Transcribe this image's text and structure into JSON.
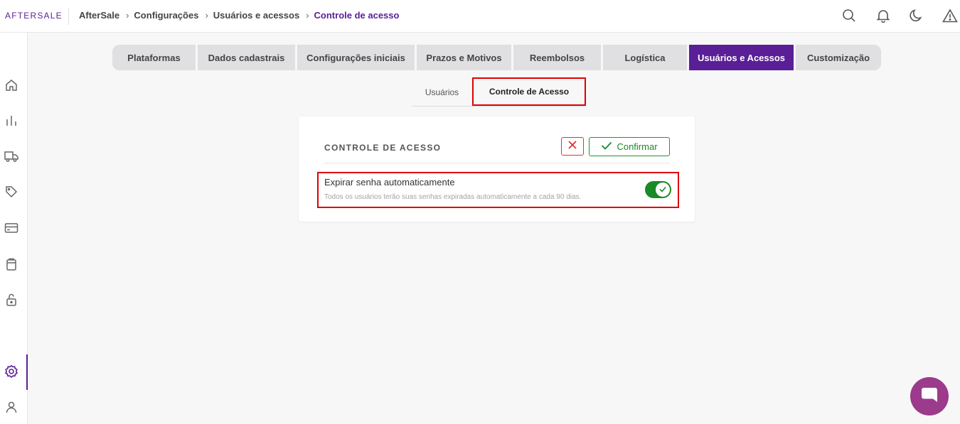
{
  "app": {
    "logo": "AFTERSALE"
  },
  "breadcrumb": {
    "items": [
      "AfterSale",
      "Configurações",
      "Usuários e acessos"
    ],
    "current": "Controle de acesso",
    "separator": "›"
  },
  "top_icons": [
    "search-icon",
    "bell-icon",
    "moon-icon",
    "warning-icon"
  ],
  "sidebar": {
    "icons": [
      "home-icon",
      "chart-icon",
      "truck-icon",
      "tag-icon",
      "credit-card-icon",
      "clipboard-icon",
      "lock-icon",
      "settings-icon",
      "user-icon"
    ],
    "active": "settings-icon"
  },
  "tabs": [
    {
      "label": "Plataformas",
      "active": false
    },
    {
      "label": "Dados cadastrais",
      "active": false
    },
    {
      "label": "Configurações iniciais",
      "active": false
    },
    {
      "label": "Prazos e Motivos",
      "active": false
    },
    {
      "label": "Reembolsos",
      "active": false
    },
    {
      "label": "Logística",
      "active": false
    },
    {
      "label": "Usuários e Acessos",
      "active": true
    },
    {
      "label": "Customização",
      "active": false
    }
  ],
  "subtabs": [
    {
      "label": "Usuários",
      "active": false
    },
    {
      "label": "Controle de Acesso",
      "active": true
    }
  ],
  "card": {
    "title": "CONTROLE DE ACESSO",
    "confirm_label": "Confirmar",
    "setting": {
      "label": "Expirar senha automaticamente",
      "description": "Todos os usuários terão suas senhas expiradas automaticamente a cada 90 dias.",
      "enabled": true
    }
  },
  "colors": {
    "brand": "#5a1e96",
    "confirm": "#1a8a26",
    "cancel": "#e03232",
    "chat": "#9c3a8c"
  }
}
